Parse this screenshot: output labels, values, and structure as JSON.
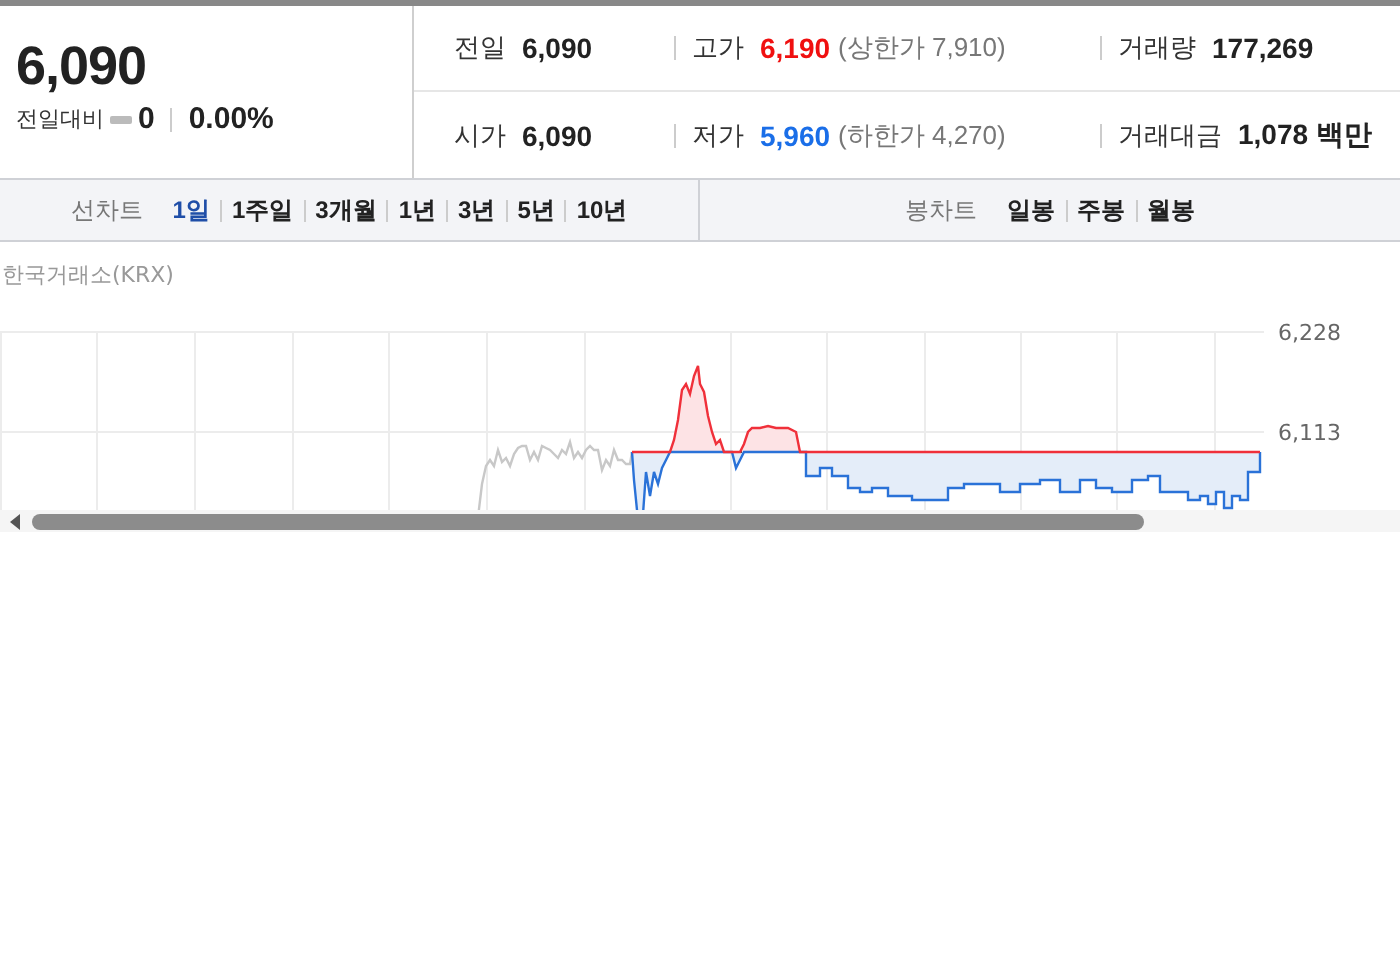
{
  "quote": {
    "price": "6,090",
    "change_label": "전일대비",
    "change": "0",
    "change_rate": "0.00%"
  },
  "stats": [
    {
      "label": "전일",
      "value": "6,090",
      "kind": "flat"
    },
    {
      "label": "고가",
      "value": "6,190",
      "kind": "up",
      "note": "(상한가 7,910)"
    },
    {
      "label": "거래량",
      "value": "177,269",
      "kind": "flat"
    },
    {
      "label": "시가",
      "value": "6,090",
      "kind": "flat"
    },
    {
      "label": "저가",
      "value": "5,960",
      "kind": "down",
      "note": "(하한가 4,270)"
    },
    {
      "label": "거래대금",
      "value": "1,078 백만",
      "kind": "flat"
    }
  ],
  "line_chart": {
    "label": "선차트",
    "periods": [
      {
        "label": "1일",
        "selected": true
      },
      {
        "label": "1주일",
        "selected": false
      },
      {
        "label": "3개월",
        "selected": false
      },
      {
        "label": "1년",
        "selected": false
      },
      {
        "label": "3년",
        "selected": false
      },
      {
        "label": "5년",
        "selected": false
      },
      {
        "label": "10년",
        "selected": false
      }
    ]
  },
  "candle_chart": {
    "label": "봉차트",
    "periods": [
      {
        "label": "일봉",
        "selected": false
      },
      {
        "label": "주봉",
        "selected": false
      },
      {
        "label": "월봉",
        "selected": false
      }
    ]
  },
  "chart": {
    "source": "한국거래소(KRX)",
    "y_labels": [
      "6,228",
      "6,113"
    ]
  }
}
